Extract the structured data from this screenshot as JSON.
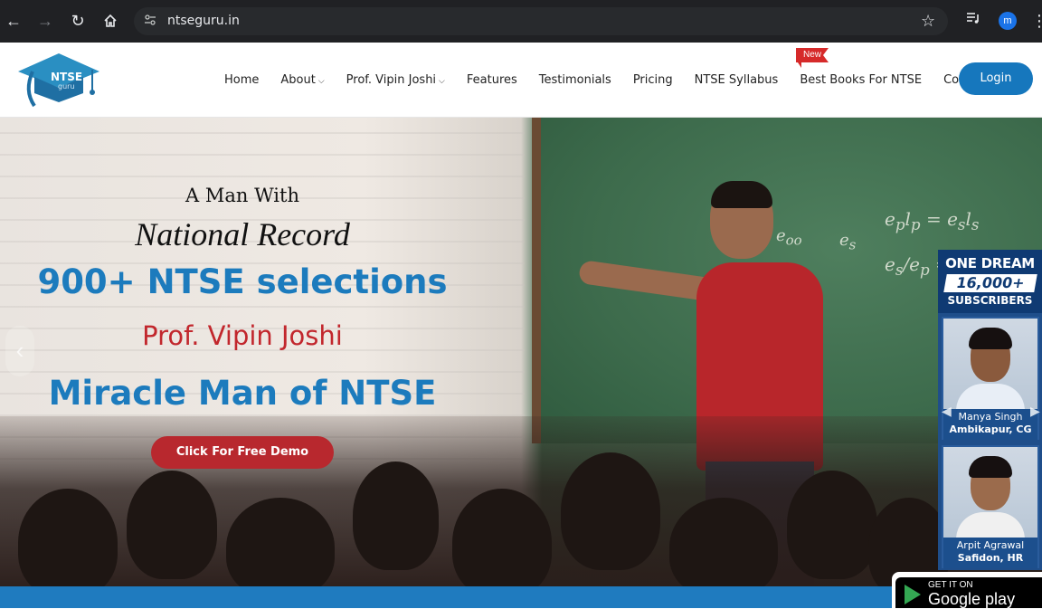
{
  "browser": {
    "url": "ntseguru.in",
    "profile_initial": "m",
    "icons": [
      "back-icon",
      "forward-icon",
      "reload-icon",
      "home-icon",
      "site-info-icon",
      "bookmark-star-icon",
      "media-controls-icon",
      "menu-kebab-icon"
    ]
  },
  "header": {
    "logo": {
      "title": "NTSE",
      "subtitle": "guru"
    },
    "nav": [
      {
        "label": "Home",
        "has_caret": false
      },
      {
        "label": "About",
        "has_caret": true
      },
      {
        "label": "Prof. Vipin Joshi",
        "has_caret": true
      },
      {
        "label": "Features",
        "has_caret": false
      },
      {
        "label": "Testimonials",
        "has_caret": false
      },
      {
        "label": "Pricing",
        "has_caret": false
      },
      {
        "label": "NTSE Syllabus",
        "has_caret": false
      },
      {
        "label": "Best Books For NTSE",
        "has_caret": false
      },
      {
        "label": "Contact Us",
        "has_caret": false
      }
    ],
    "new_badge": "New",
    "login_label": "Login"
  },
  "hero": {
    "line1": "A Man With",
    "line2": "National Record",
    "line3": "900+ NTSE selections",
    "line4": "Prof. Vipin Joshi",
    "line5": "Miracle Man of NTSE",
    "cta_label": "Click For Free Demo"
  },
  "promo": {
    "line1": "ONE DREAM",
    "line2": "16,000+",
    "line3": "SUBSCRIBERS",
    "students": [
      {
        "name": "Manya Singh",
        "place": "Ambikapur, CG"
      },
      {
        "name": "Arpit Agrawal",
        "place": "Safidon, HR"
      }
    ]
  },
  "google_play": {
    "line1": "GET IT ON",
    "line2": "Google play"
  },
  "colors": {
    "brand_blue": "#1c7bbd",
    "brand_red": "#c2272d",
    "login_blue": "#1677bd"
  }
}
